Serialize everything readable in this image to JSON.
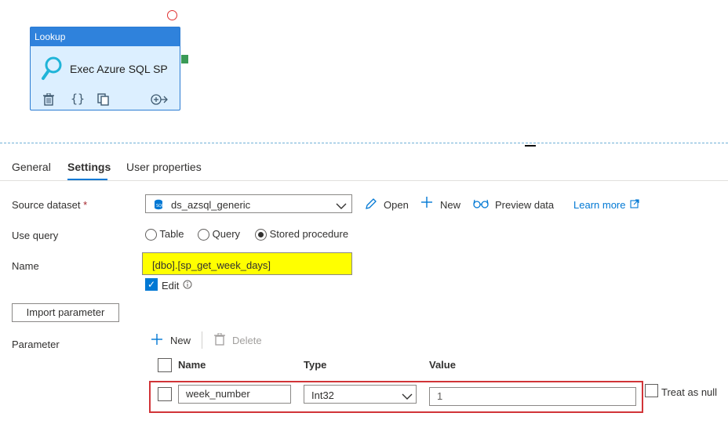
{
  "activity": {
    "type_label": "Lookup",
    "name": "Exec Azure SQL SP",
    "icons": [
      "delete-icon",
      "code-icon",
      "copy-icon",
      "add-output-icon",
      "lookup-search-icon"
    ]
  },
  "tabs": [
    {
      "label": "General",
      "active": false
    },
    {
      "label": "Settings",
      "active": true
    },
    {
      "label": "User properties",
      "active": false
    }
  ],
  "settings": {
    "source_dataset_label": "Source dataset",
    "required_mark": "*",
    "source_dataset_value": "ds_azsql_generic",
    "open_label": "Open",
    "new_label": "New",
    "preview_label": "Preview data",
    "learn_more_label": "Learn more",
    "use_query_label": "Use query",
    "query_options": [
      "Table",
      "Query",
      "Stored procedure"
    ],
    "selected_query_option": "Stored procedure",
    "name_label": "Name",
    "sp_name": "[dbo].[sp_get_week_days]",
    "edit_label": "Edit",
    "edit_checked": true,
    "import_parameter_label": "Import parameter",
    "parameter_label": "Parameter",
    "param_new_label": "New",
    "param_delete_label": "Delete"
  },
  "parameters": {
    "columns": [
      "Name",
      "Type",
      "Value"
    ],
    "rows": [
      {
        "name": "week_number",
        "type": "Int32",
        "value": "1",
        "treat_as_null_label": "Treat as null",
        "treat_as_null": false
      }
    ]
  },
  "colors": {
    "accent": "#0078d4",
    "highlight": "#ffff00",
    "error_outline": "#d13438",
    "card_header": "#2f82dc"
  }
}
